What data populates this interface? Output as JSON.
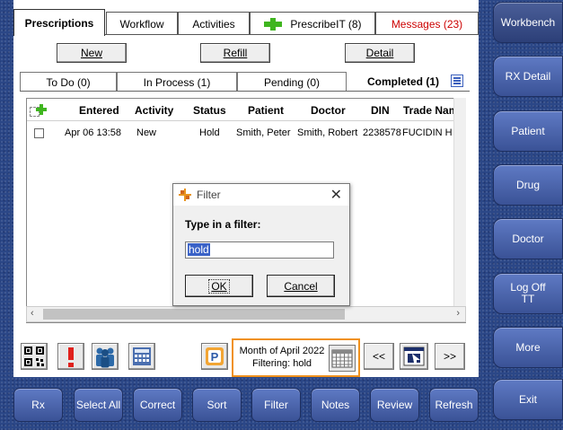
{
  "main_tabs": {
    "prescriptions": "Prescriptions",
    "workflow": "Workflow",
    "activities": "Activities",
    "prescribeit": "PrescribeIT (8)",
    "messages": "Messages (23)"
  },
  "actions": {
    "new": "New",
    "refill": "Refill",
    "detail": "Detail"
  },
  "sub_tabs": {
    "todo": "To Do (0)",
    "in_process": "In Process (1)",
    "pending": "Pending (0)",
    "completed": "Completed (1)"
  },
  "grid": {
    "columns": [
      "Entered",
      "Activity",
      "Status",
      "Patient",
      "Doctor",
      "DIN",
      "Trade Nam"
    ],
    "rows": [
      {
        "entered": "Apr 06 13:58",
        "activity": "New",
        "status": "Hold",
        "patient": "Smith, Peter",
        "doctor": "Smith, Robert",
        "din": "2238578",
        "trade_name": "FUCIDIN H"
      }
    ]
  },
  "dialog": {
    "title": "Filter",
    "label": "Type in a filter:",
    "value": "hold",
    "ok": "OK",
    "cancel": "Cancel"
  },
  "date_box": {
    "month": "Month of April 2022",
    "filter": "Filtering: hold"
  },
  "nav": {
    "prev": "<<",
    "next": ">>"
  },
  "bottom_buttons": [
    "Rx",
    "Select All",
    "Correct",
    "Sort",
    "Filter",
    "Notes",
    "Review",
    "Refresh"
  ],
  "side_buttons": [
    "Workbench",
    "RX Detail",
    "Patient",
    "Drug",
    "Doctor",
    "Log Off TT",
    "More",
    "Exit"
  ],
  "colors": {
    "accent_orange": "#f0911d",
    "plus_green": "#3fb51f",
    "messages_red": "#cc0000",
    "button_blue": "#4a64ae"
  }
}
